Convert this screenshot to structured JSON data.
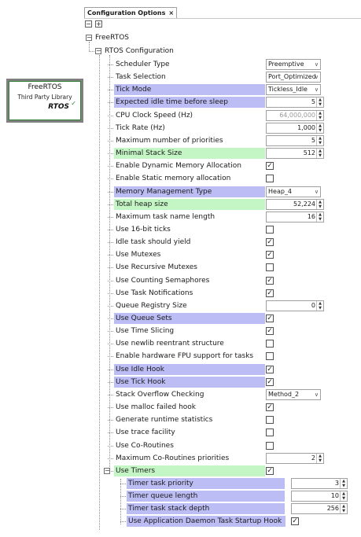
{
  "tab": {
    "title": "Configuration Options",
    "close": "×"
  },
  "toolbar": {
    "collapse": "−",
    "expand": "+"
  },
  "component": {
    "title": "FreeRTOS",
    "subtitle": "Third Party Library",
    "logo": "RTOS"
  },
  "tree": {
    "root": "FreeRTOS",
    "config": "RTOS Configuration"
  },
  "rows": [
    {
      "label": "Scheduler Type",
      "kind": "dropdown",
      "value": "Preemptive",
      "hl": "none"
    },
    {
      "label": "Task Selection",
      "kind": "dropdown",
      "value": "Port_Optimized",
      "hl": "none"
    },
    {
      "label": "Tick Mode",
      "kind": "dropdown",
      "value": "Tickless_Idle",
      "hl": "blue"
    },
    {
      "label": "Expected idle time before sleep",
      "kind": "spin",
      "value": "5",
      "hl": "blue"
    },
    {
      "label": "CPU Clock Speed (Hz)",
      "kind": "spin",
      "value": "64,000,000",
      "hl": "none",
      "disabled": true
    },
    {
      "label": "Tick Rate (Hz)",
      "kind": "spin",
      "value": "1,000",
      "hl": "none"
    },
    {
      "label": "Maximum number of priorities",
      "kind": "spin",
      "value": "5",
      "hl": "none"
    },
    {
      "label": "Minimal Stack Size",
      "kind": "spin",
      "value": "512",
      "hl": "green"
    },
    {
      "label": "Enable Dynamic Memory Allocation",
      "kind": "check",
      "checked": true,
      "hl": "none"
    },
    {
      "label": "Enable Static memory allocation",
      "kind": "check",
      "checked": false,
      "hl": "none"
    },
    {
      "label": "Memory Management Type",
      "kind": "dropdown",
      "value": "Heap_4",
      "hl": "blue"
    },
    {
      "label": "Total heap size",
      "kind": "spin",
      "value": "52,224",
      "hl": "green"
    },
    {
      "label": "Maximum task name length",
      "kind": "spin",
      "value": "16",
      "hl": "none"
    },
    {
      "label": "Use 16-bit ticks",
      "kind": "check",
      "checked": false,
      "hl": "none"
    },
    {
      "label": "Idle task should yield",
      "kind": "check",
      "checked": true,
      "hl": "none"
    },
    {
      "label": "Use Mutexes",
      "kind": "check",
      "checked": true,
      "hl": "none"
    },
    {
      "label": "Use Recursive Mutexes",
      "kind": "check",
      "checked": false,
      "hl": "none"
    },
    {
      "label": "Use Counting Semaphores",
      "kind": "check",
      "checked": true,
      "hl": "none"
    },
    {
      "label": "Use Task Notifications",
      "kind": "check",
      "checked": true,
      "hl": "none"
    },
    {
      "label": "Queue Registry Size",
      "kind": "spin",
      "value": "0",
      "hl": "none"
    },
    {
      "label": "Use Queue Sets",
      "kind": "check",
      "checked": true,
      "hl": "blue"
    },
    {
      "label": "Use Time Slicing",
      "kind": "check",
      "checked": true,
      "hl": "none"
    },
    {
      "label": "Use newlib reentrant structure",
      "kind": "check",
      "checked": false,
      "hl": "none"
    },
    {
      "label": "Enable hardware FPU support for tasks",
      "kind": "check",
      "checked": false,
      "hl": "none"
    },
    {
      "label": "Use Idle Hook",
      "kind": "check",
      "checked": true,
      "hl": "blue"
    },
    {
      "label": "Use Tick Hook",
      "kind": "check",
      "checked": true,
      "hl": "blue"
    },
    {
      "label": "Stack Overflow Checking",
      "kind": "dropdown",
      "value": "Method_2",
      "hl": "none"
    },
    {
      "label": "Use malloc failed hook",
      "kind": "check",
      "checked": true,
      "hl": "none"
    },
    {
      "label": "Generate runtime statistics",
      "kind": "check",
      "checked": false,
      "hl": "none"
    },
    {
      "label": "Use trace facility",
      "kind": "check",
      "checked": false,
      "hl": "none"
    },
    {
      "label": "Use Co-Routines",
      "kind": "check",
      "checked": false,
      "hl": "none"
    },
    {
      "label": "Maximum Co-Routines priorities",
      "kind": "spin",
      "value": "2",
      "hl": "none"
    },
    {
      "label": "Use Timers",
      "kind": "check",
      "checked": true,
      "hl": "green",
      "expander": true
    }
  ],
  "timer_rows": [
    {
      "label": "Timer task priority",
      "kind": "spin",
      "value": "3",
      "hl": "blue"
    },
    {
      "label": "Timer queue length",
      "kind": "spin",
      "value": "10",
      "hl": "blue"
    },
    {
      "label": "Timer task stack depth",
      "kind": "spin",
      "value": "256",
      "hl": "blue"
    },
    {
      "label": "Use Application Daemon Task Startup Hook",
      "kind": "check",
      "checked": true,
      "hl": "blue"
    }
  ],
  "colors": {
    "blue_highlight": "#bdbdf5",
    "green_highlight": "#c4f5c4"
  }
}
